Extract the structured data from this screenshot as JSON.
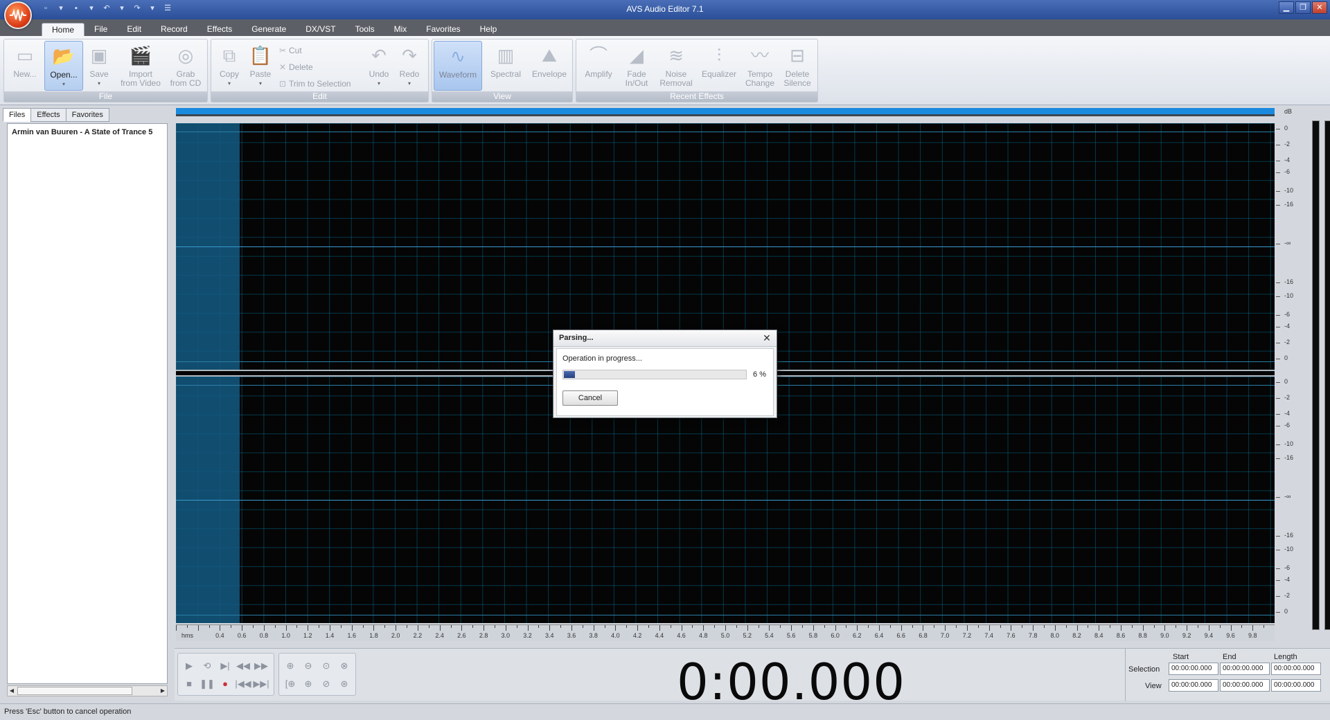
{
  "window": {
    "title": "AVS Audio Editor 7.1",
    "min": "▁",
    "max": "❐",
    "close": "✕"
  },
  "qat": [
    "▫",
    "▾",
    "▪",
    "▾",
    "↶",
    "▾",
    "↷",
    "▾",
    "☰"
  ],
  "menu": {
    "tabs": [
      {
        "label": "Home",
        "active": true
      },
      {
        "label": "File"
      },
      {
        "label": "Edit"
      },
      {
        "label": "Record"
      },
      {
        "label": "Effects"
      },
      {
        "label": "Generate"
      },
      {
        "label": "DX/VST"
      },
      {
        "label": "Tools"
      },
      {
        "label": "Mix"
      },
      {
        "label": "Favorites"
      },
      {
        "label": "Help"
      }
    ]
  },
  "ribbon": {
    "file": {
      "label": "File",
      "new": "New...",
      "open": "Open...",
      "save": "Save",
      "import1": "Import",
      "import2": "from Video",
      "grab1": "Grab",
      "grab2": "from CD"
    },
    "edit": {
      "label": "Edit",
      "copy": "Copy",
      "paste": "Paste",
      "cut": "Cut",
      "delete": "Delete",
      "trim": "Trim to Selection",
      "undo": "Undo",
      "redo": "Redo"
    },
    "view": {
      "label": "View",
      "waveform": "Waveform",
      "spectral": "Spectral",
      "envelope": "Envelope"
    },
    "recent": {
      "label": "Recent Effects",
      "amplify": "Amplify",
      "fade1": "Fade",
      "fade2": "In/Out",
      "noise1": "Noise",
      "noise2": "Removal",
      "equalizer": "Equalizer",
      "tempo1": "Tempo",
      "tempo2": "Change",
      "silence1": "Delete",
      "silence2": "Silence"
    }
  },
  "leftpanel": {
    "tabs": [
      "Files",
      "Effects",
      "Favorites"
    ],
    "file_name": "Armin van Buuren - A State of Trance 5"
  },
  "ruler": {
    "unit": "hms",
    "labels": [
      "0.4",
      "0.6",
      "0.8",
      "1.0",
      "1.2",
      "1.4",
      "1.6",
      "1.8",
      "2.0",
      "2.2",
      "2.4",
      "2.6",
      "2.8",
      "3.0",
      "3.2",
      "3.4",
      "3.6",
      "3.8",
      "4.0",
      "4.2",
      "4.4",
      "4.6",
      "4.8",
      "5.0",
      "5.2",
      "5.4",
      "5.6",
      "5.8",
      "6.0",
      "6.2",
      "6.4",
      "6.6",
      "6.8",
      "7.0",
      "7.2",
      "7.4",
      "7.6",
      "7.8",
      "8.0",
      "8.2",
      "8.4",
      "8.6",
      "8.8",
      "9.0",
      "9.2",
      "9.4",
      "9.6",
      "9.8"
    ]
  },
  "db_scale": {
    "unit": "dB",
    "labels": [
      "0",
      "-2",
      "-4",
      "-6",
      "-10",
      "-16",
      "-∞",
      "-16",
      "-10",
      "-6",
      "-4",
      "-2",
      "0",
      "0",
      "-2",
      "-4",
      "-6",
      "-10",
      "-16",
      "-∞",
      "-16",
      "-10",
      "-6",
      "-4",
      "-2",
      "0"
    ]
  },
  "transport": {
    "timecode": "0:00.000",
    "buttons_row1": [
      "▶",
      "⟲",
      "▶|",
      "◀◀",
      "▶▶",
      "⊕",
      "⊖",
      "⊙",
      "⊗"
    ],
    "buttons_row2": [
      "■",
      "❚❚",
      "●",
      "|◀◀",
      "▶▶|",
      "[⊕",
      "⊕",
      "⊘",
      "⊛"
    ]
  },
  "selection": {
    "head_start": "Start",
    "head_end": "End",
    "head_length": "Length",
    "sel_label": "Selection",
    "view_label": "View",
    "sel_start": "00:00:00.000",
    "sel_end": "00:00:00.000",
    "sel_length": "00:00:00.000",
    "view_start": "00:00:00.000",
    "view_end": "00:00:00.000",
    "view_length": "00:00:00.000"
  },
  "status": {
    "text": "Press 'Esc' button to cancel operation"
  },
  "dialog": {
    "title": "Parsing...",
    "message": "Operation in progress...",
    "progress": 0.06,
    "percent_label": "6 %",
    "cancel": "Cancel"
  }
}
